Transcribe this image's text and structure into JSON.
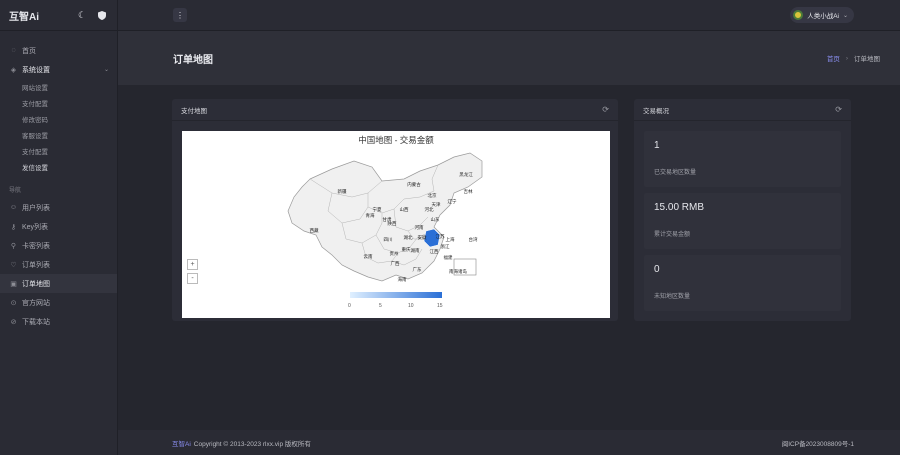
{
  "brand": {
    "title": "互智Ai"
  },
  "sidebar": {
    "home": "首页",
    "system": "系统设置",
    "sub_items": [
      "网站设置",
      "支付配置",
      "修改密码",
      "客服设置",
      "支付配置",
      "发信设置"
    ],
    "nav_title": "导航",
    "nav_items": [
      {
        "label": "用户列表",
        "icon": "user-icon"
      },
      {
        "label": "Key列表",
        "icon": "key-icon"
      },
      {
        "label": "卡密列表",
        "icon": "card-icon"
      },
      {
        "label": "订单列表",
        "icon": "order-icon"
      },
      {
        "label": "订单地图",
        "icon": "map-icon"
      },
      {
        "label": "官方网站",
        "icon": "globe-icon"
      },
      {
        "label": "下载本站",
        "icon": "download-icon"
      }
    ]
  },
  "topbar": {
    "user_name": "人类小战Ai"
  },
  "page": {
    "title": "订单地图"
  },
  "breadcrumb": {
    "home": "首页",
    "current": "订单地图"
  },
  "map_card": {
    "header": "支付地图",
    "map_title": "中国地图 - 交易金额",
    "zoom_in": "+",
    "zoom_out": "-",
    "legend_ticks": [
      "0",
      "5",
      "10",
      "15"
    ],
    "highlight_color": "#2a6fd6",
    "provinces": [
      "黑龙江",
      "吉林",
      "辽宁",
      "内蒙古",
      "新疆",
      "甘肃",
      "青海",
      "西藏",
      "宁夏",
      "陕西",
      "山西",
      "河北",
      "北京",
      "天津",
      "山东",
      "河南",
      "江苏",
      "上海",
      "浙江",
      "安徽",
      "湖北",
      "四川",
      "重庆",
      "贵州",
      "湖南",
      "江西",
      "福建",
      "云南",
      "广西",
      "广东",
      "海南",
      "台湾",
      "南海诸岛"
    ]
  },
  "stats_card": {
    "header": "交易概况",
    "stats": [
      {
        "value": "1",
        "label": "已交易地区数量"
      },
      {
        "value": "15.00 RMB",
        "label": "累计交易金额"
      },
      {
        "value": "0",
        "label": "未知地区数量"
      }
    ]
  },
  "footer": {
    "brand": "互智Ai",
    "copyright": "Copyright © 2013-2023 rlxx.vip 版权所有",
    "icp": "闽ICP备2023008809号-1"
  }
}
